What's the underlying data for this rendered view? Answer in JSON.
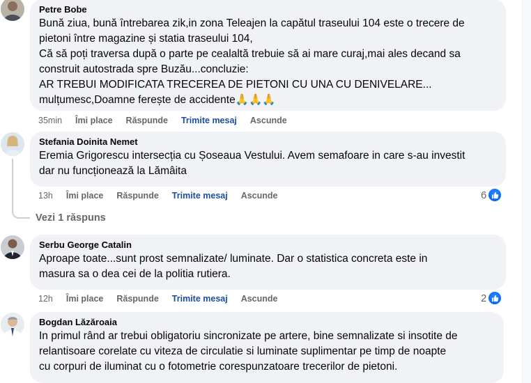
{
  "comments": [
    {
      "author": "Petre Bobe",
      "text": "Bună ziua, bună întrebarea zik,in zona Teleajen la capătul traseului 104 este o trecere de\npietoni între magazine și statia traseului 104,\nCă să poți traversa după o parte pe cealaltă trebuie să ai mare curaj,mai ales decand sa\nconstruit autostrada spre Buzău...concluzie:\nAR TREBUI MODIFICATA TRECEREA DE PIETONI CU UNA CU DENIVELARE...\nmulțumesc,Doamne ferește de accidente🙏🙏🙏",
      "time": "35min",
      "like": "Îmi place",
      "reply": "Răspunde",
      "message": "Trimite mesaj",
      "hide": "Ascunde"
    },
    {
      "author": "Stefania Doinita Nemet",
      "text": "Eremia Grigorescu intersecția cu Șoseaua Vestului. Avem semafoare in care s-au investit\ndar nu funcționează la Lămâita",
      "time": "13h",
      "like": "Îmi place",
      "reply": "Răspunde",
      "message": "Trimite mesaj",
      "hide": "Ascunde",
      "reactions": "6",
      "replies_link": "Vezi 1 răspuns"
    },
    {
      "author": "Serbu George Catalin",
      "text": "Aproape toate...sunt prost semnalizate/ luminate. Dar o statistica concreta este in\nmasura sa o dea cei de la politia rutiera.",
      "time": "12h",
      "like": "Îmi place",
      "reply": "Răspunde",
      "message": "Trimite mesaj",
      "hide": "Ascunde",
      "reactions": "2"
    },
    {
      "author": "Bogdan Lăzăroaia",
      "text": "In primul rând ar trebui obligatoriu sincronizate pe artere, bine semnalizate si insotite de\nrelantisoare corelate cu viteza de circulatie si luminate suplimentar pe timp de noapte\ncu corpuri de iluminat cu o fotometrie corespunzatoare trecerilor de pietoni."
    }
  ],
  "colors": {
    "bubble": "#f0f2f5",
    "muted": "#65676b",
    "link": "#1b4ea0",
    "like_blue": "#0866ff"
  }
}
